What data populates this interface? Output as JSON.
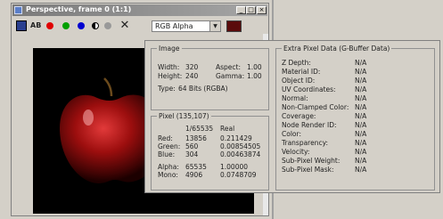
{
  "window": {
    "title": "Perspective, frame 0 (1:1)"
  },
  "toolbar": {
    "channel_value": "RGB Alpha"
  },
  "image": {
    "group_label": "Image",
    "width_label": "Width:",
    "width": "320",
    "height_label": "Height:",
    "height": "240",
    "aspect_label": "Aspect:",
    "aspect": "1.00",
    "gamma_label": "Gamma:",
    "gamma": "1.00",
    "type_label": "Type:",
    "type": "64 Bits (RGBA)"
  },
  "pixel": {
    "group_label": "Pixel (135,107)",
    "col_int": "1/65535",
    "col_real": "Real",
    "rows": [
      {
        "label": "Red:",
        "int": "13856",
        "real": "0.211429"
      },
      {
        "label": "Green:",
        "int": "560",
        "real": "0.00854505"
      },
      {
        "label": "Blue:",
        "int": "304",
        "real": "0.00463874"
      },
      {
        "label": "Alpha:",
        "int": "65535",
        "real": "1.00000"
      },
      {
        "label": "Mono:",
        "int": "4906",
        "real": "0.0748709"
      }
    ]
  },
  "extra": {
    "group_label": "Extra Pixel Data (G-Buffer Data)",
    "rows": [
      {
        "label": "Z Depth:",
        "value": "N/A"
      },
      {
        "label": "Material ID:",
        "value": "N/A"
      },
      {
        "label": "Object ID:",
        "value": "N/A"
      },
      {
        "label": "UV Coordinates:",
        "value": "N/A"
      },
      {
        "label": "Normal:",
        "value": "N/A"
      },
      {
        "label": "Non-Clamped Color:",
        "value": "N/A"
      },
      {
        "label": "Coverage:",
        "value": "N/A"
      },
      {
        "label": "Node Render ID:",
        "value": "N/A"
      },
      {
        "label": "Color:",
        "value": "N/A"
      },
      {
        "label": "Transparency:",
        "value": "N/A"
      },
      {
        "label": "Velocity:",
        "value": "N/A"
      },
      {
        "label": "Sub-Pixel Weight:",
        "value": "N/A"
      },
      {
        "label": "Sub-Pixel Mask:",
        "value": "N/A"
      }
    ]
  }
}
